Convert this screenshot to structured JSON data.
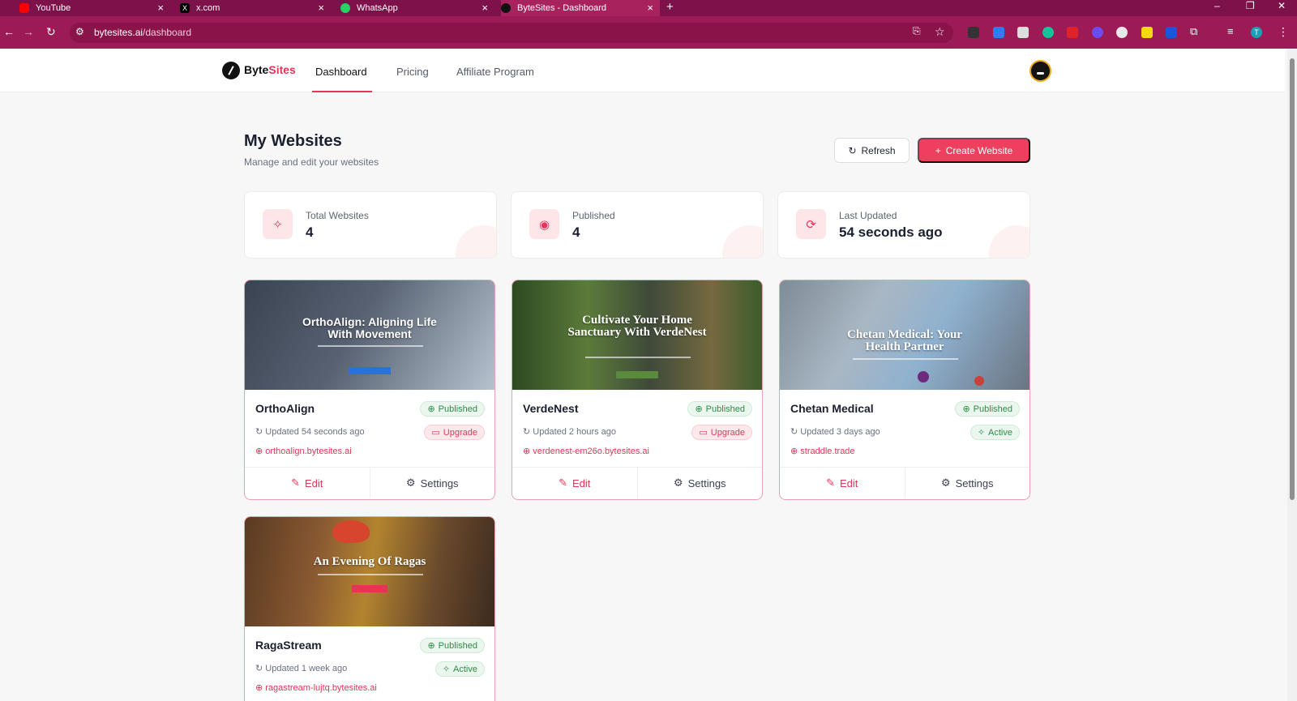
{
  "browser": {
    "tabs": [
      {
        "title": "YouTube",
        "icon": "youtube-icon",
        "active": false
      },
      {
        "title": "x.com",
        "icon": "x-icon",
        "active": false
      },
      {
        "title": "WhatsApp",
        "icon": "whatsapp-icon",
        "active": false
      },
      {
        "title": "ByteSites - Dashboard",
        "icon": "bytesites-icon",
        "active": true
      }
    ],
    "url_host": "bytesites.ai",
    "url_path": "/dashboard",
    "profile_initial": "T"
  },
  "app": {
    "logo_main": "Byte",
    "logo_accent": "Sites",
    "nav": [
      "Dashboard",
      "Pricing",
      "Affiliate Program"
    ],
    "active_nav": "Dashboard"
  },
  "page": {
    "title": "My Websites",
    "subtitle": "Manage and edit your websites",
    "refresh_label": "Refresh",
    "create_label": "Create Website"
  },
  "stats": [
    {
      "label": "Total Websites",
      "value": "4",
      "icon": "sparkles-icon"
    },
    {
      "label": "Published",
      "value": "4",
      "icon": "eye-icon"
    },
    {
      "label": "Last Updated",
      "value": "54 seconds ago",
      "icon": "refresh-icon"
    }
  ],
  "sites": [
    {
      "name": "OrthoAlign",
      "status": "Published",
      "plan": "Upgrade",
      "updated": "Updated 54 seconds ago",
      "domain": "orthoalign.bytesites.ai",
      "preview_title": "OrthoAlign: Aligning Life With Movement",
      "edit": "Edit",
      "settings": "Settings"
    },
    {
      "name": "VerdeNest",
      "status": "Published",
      "plan": "Upgrade",
      "updated": "Updated 2 hours ago",
      "domain": "verdenest-em26o.bytesites.ai",
      "preview_title": "Cultivate Your Home Sanctuary With VerdeNest",
      "edit": "Edit",
      "settings": "Settings"
    },
    {
      "name": "Chetan Medical",
      "status": "Published",
      "plan": "Active",
      "updated": "Updated 3 days ago",
      "domain": "straddle.trade",
      "preview_title": "Chetan Medical: Your Health Partner",
      "edit": "Edit",
      "settings": "Settings"
    },
    {
      "name": "RagaStream",
      "status": "Published",
      "plan": "Active",
      "updated": "Updated 1 week ago",
      "domain": "ragastream-lujtq.bytesites.ai",
      "preview_title": "An Evening Of Ragas"
    }
  ],
  "colors": {
    "accent": "#ef3f5e",
    "browser_frame": "#9c1a55",
    "published": "#2e8a48"
  }
}
